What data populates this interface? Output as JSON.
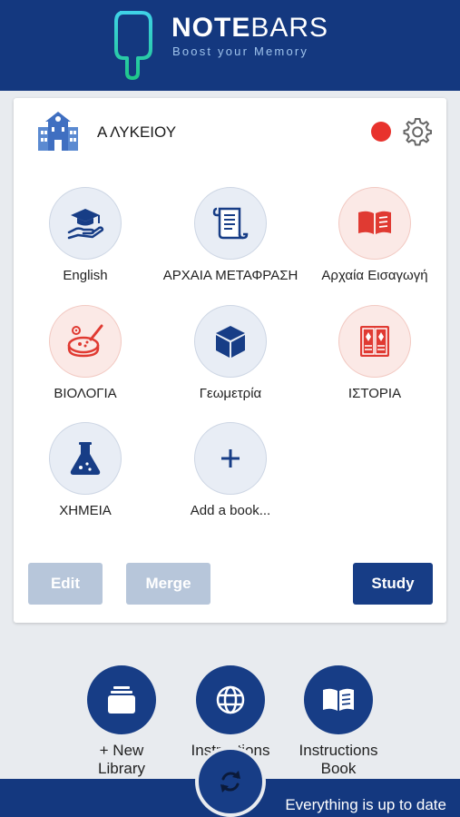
{
  "header": {
    "logo_bold": "NOTE",
    "logo_light": "BARS",
    "tagline": "Boost your Memory"
  },
  "library": {
    "title": "Α ΛΥΚΕΙΟΥ",
    "status_color": "#e8322d",
    "books": [
      {
        "label": "English",
        "icon": "education-hand-icon",
        "tint": "blue"
      },
      {
        "label": "ΑΡΧΑΙΑ ΜΕΤΑΦΡΑΣΗ",
        "icon": "scroll-icon",
        "tint": "blue"
      },
      {
        "label": "Αρχαία Εισαγωγή",
        "icon": "open-book-icon",
        "tint": "red"
      },
      {
        "label": "ΒΙΟΛΟΓΙΑ",
        "icon": "petri-dish-icon",
        "tint": "red"
      },
      {
        "label": "Γεωμετρία",
        "icon": "cube-icon",
        "tint": "blue"
      },
      {
        "label": "ΙΣΤΟΡΙΑ",
        "icon": "history-book-icon",
        "tint": "red"
      },
      {
        "label": "ΧΗΜΕΙΑ",
        "icon": "flask-icon",
        "tint": "blue"
      },
      {
        "label": "Add a book...",
        "icon": "plus-icon",
        "tint": "blue"
      }
    ],
    "buttons": {
      "edit": "Edit",
      "merge": "Merge",
      "study": "Study"
    }
  },
  "actions": {
    "new_library": "+ New\nLibrary",
    "instructions": "Instructions",
    "instructions_book": "Instructions\nBook"
  },
  "footer": {
    "status": "Everything is up to date"
  },
  "colors": {
    "brand": "#14387f",
    "accent": "#173d86",
    "red": "#e8322d"
  }
}
